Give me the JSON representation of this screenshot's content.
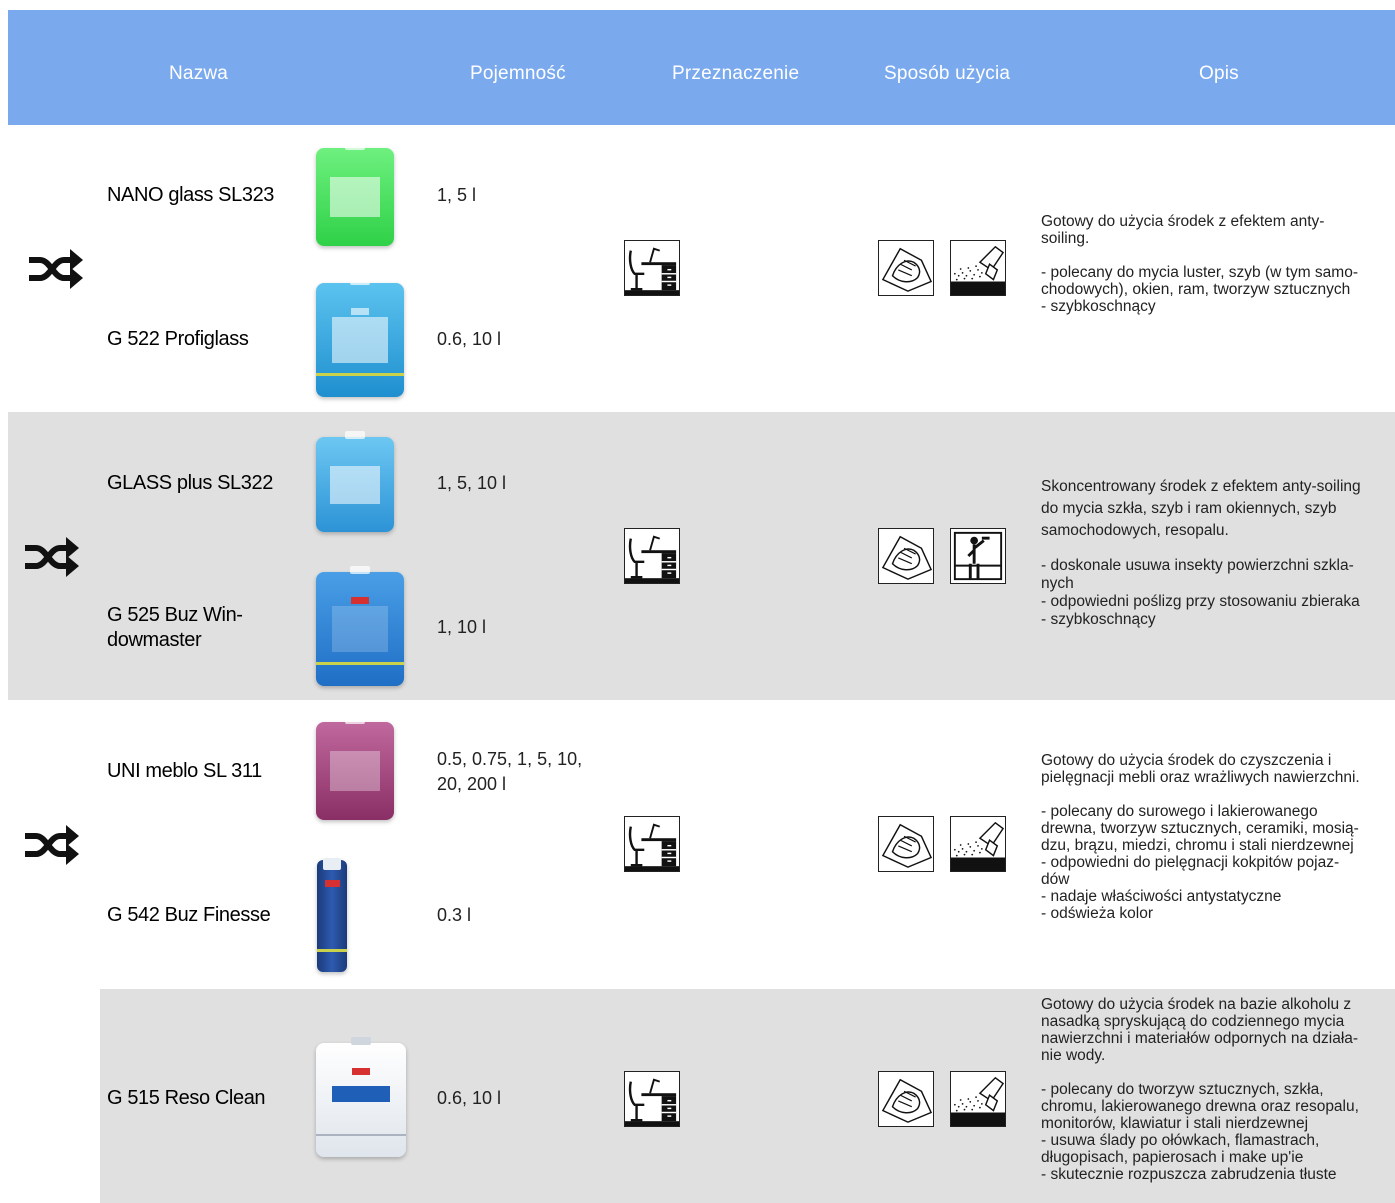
{
  "header": {
    "col_name": "Nazwa",
    "col_capacity": "Pojemność",
    "col_purpose": "Przeznaczenie",
    "col_usage": "Sposób użycia",
    "col_description": "Opis",
    "background": "#7aaaed"
  },
  "icons": {
    "shuffle": "shuffle-icon",
    "furniture": "desk-furniture-icon",
    "wipe": "cloth-wipe-icon",
    "spray": "spray-bottle-icon",
    "window": "window-cleaning-icon"
  },
  "colors": {
    "row_alt": "#e0e0e0",
    "green_product": "#3ee05a",
    "blue_product": "#2f9fdc",
    "purple_product": "#9c3d79",
    "white_product": "#e8edf2"
  },
  "groups": [
    {
      "products": [
        {
          "name": "NANO glass SL323",
          "capacity": "1, 5 l"
        },
        {
          "name": "G 522 Profiglass",
          "capacity": "0.6, 10 l"
        }
      ],
      "description": [
        "Gotowy do użycia środek z efektem anty-",
        "soiling.",
        "",
        "- polecany do mycia luster, szyb (w tym samo-",
        "chodowych), okien, ram, tworzyw sztucznych",
        "- szybkoschnący"
      ]
    },
    {
      "products": [
        {
          "name": "GLASS plus SL322",
          "capacity": "1, 5, 10 l"
        },
        {
          "name": "G 525 Buz Win-\ndowmaster",
          "capacity": "1, 10 l"
        }
      ],
      "description": [
        "Skoncentrowany środek z efektem anty-soiling",
        "do mycia szkła, szyb i ram okiennych, szyb",
        "samochodowych, resopalu.",
        "",
        "- doskonale usuwa insekty powierzchni szkla-",
        "nych",
        "- odpowiedni poślizg przy stosowaniu zbieraka",
        "- szybkoschnący"
      ]
    },
    {
      "products": [
        {
          "name": "UNI meblo SL 311",
          "capacity": "0.5, 0.75, 1, 5, 10,\n20, 200 l"
        },
        {
          "name": "G 542 Buz Finesse",
          "capacity": "0.3 l"
        }
      ],
      "description": [
        "Gotowy do użycia środek do czyszczenia i",
        "pielęgnacji mebli oraz wrażliwych nawierzchni.",
        "",
        "- polecany do surowego i lakierowanego",
        "drewna, tworzyw sztucznych, ceramiki, mosią-",
        "dzu, brązu, miedzi, chromu i stali nierdzewnej",
        "- odpowiedni do pielęgnacji kokpitów pojaz-",
        "dów",
        "- nadaje właściwości antystatyczne",
        "- odświeża kolor"
      ]
    },
    {
      "products": [
        {
          "name": "G 515 Reso Clean",
          "capacity": "0.6, 10 l"
        }
      ],
      "description": [
        "Gotowy do użycia środek na bazie alkoholu z",
        "nasadką spryskującą do codziennego mycia",
        "nawierzchni i materiałów odpornych na działa-",
        "nie wody.",
        "",
        "- polecany do tworzyw sztucznych, szkła,",
        "chromu, lakierowanego drewna oraz resopalu,",
        "monitorów, klawiatur i stali nierdzewnej",
        "- usuwa ślady po ołówkach, flamastrach,",
        "długopisach, papierosach i make up'ie",
        "- skutecznie rozpuszcza zabrudzenia tłuste"
      ]
    }
  ]
}
